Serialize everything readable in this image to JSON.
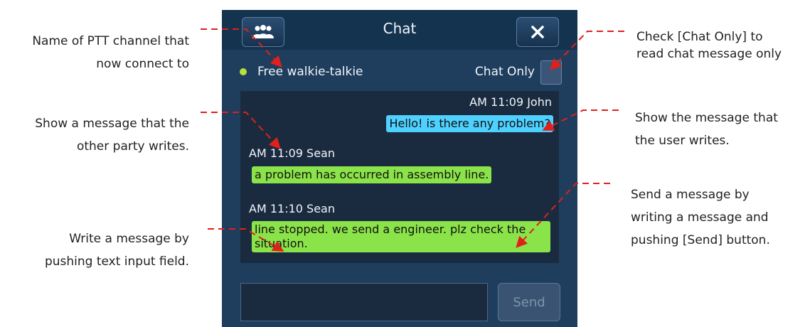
{
  "app": {
    "title": "Chat",
    "channel": "Free walkie-talkie",
    "chat_only_label": "Chat Only",
    "send_label": "Send"
  },
  "messages": [
    {
      "meta": "AM 11:09  John",
      "text": "Hello! is there any problem?"
    },
    {
      "meta": "AM 11:09  Sean",
      "text": "a problem has occurred in assembly line."
    },
    {
      "meta": "AM 11:10  Sean",
      "text_line1": "line stopped. we send a engineer. plz check the",
      "text_line2": "situation."
    }
  ],
  "annotations": {
    "channel_line1": "Name of PTT channel that",
    "channel_line2": "now connect to",
    "other_line1": "Show a message that the",
    "other_line2": "other party writes.",
    "input_line1": "Write a message by",
    "input_line2": "pushing text input field.",
    "chatonly_line1": "Check [Chat Only] to",
    "chatonly_line2": "read chat message only",
    "mine_line1": "Show the message that",
    "mine_line2": "the user writes.",
    "send_line1": "Send a message by",
    "send_line2": "writing a message and",
    "send_line3": "pushing [Send] button."
  },
  "colors": {
    "annotation": "#e0201b",
    "mine_bubble": "#4fd1ff",
    "other_bubble": "#8be34a"
  },
  "icons": {
    "members": "group-icon",
    "close": "close-icon"
  }
}
